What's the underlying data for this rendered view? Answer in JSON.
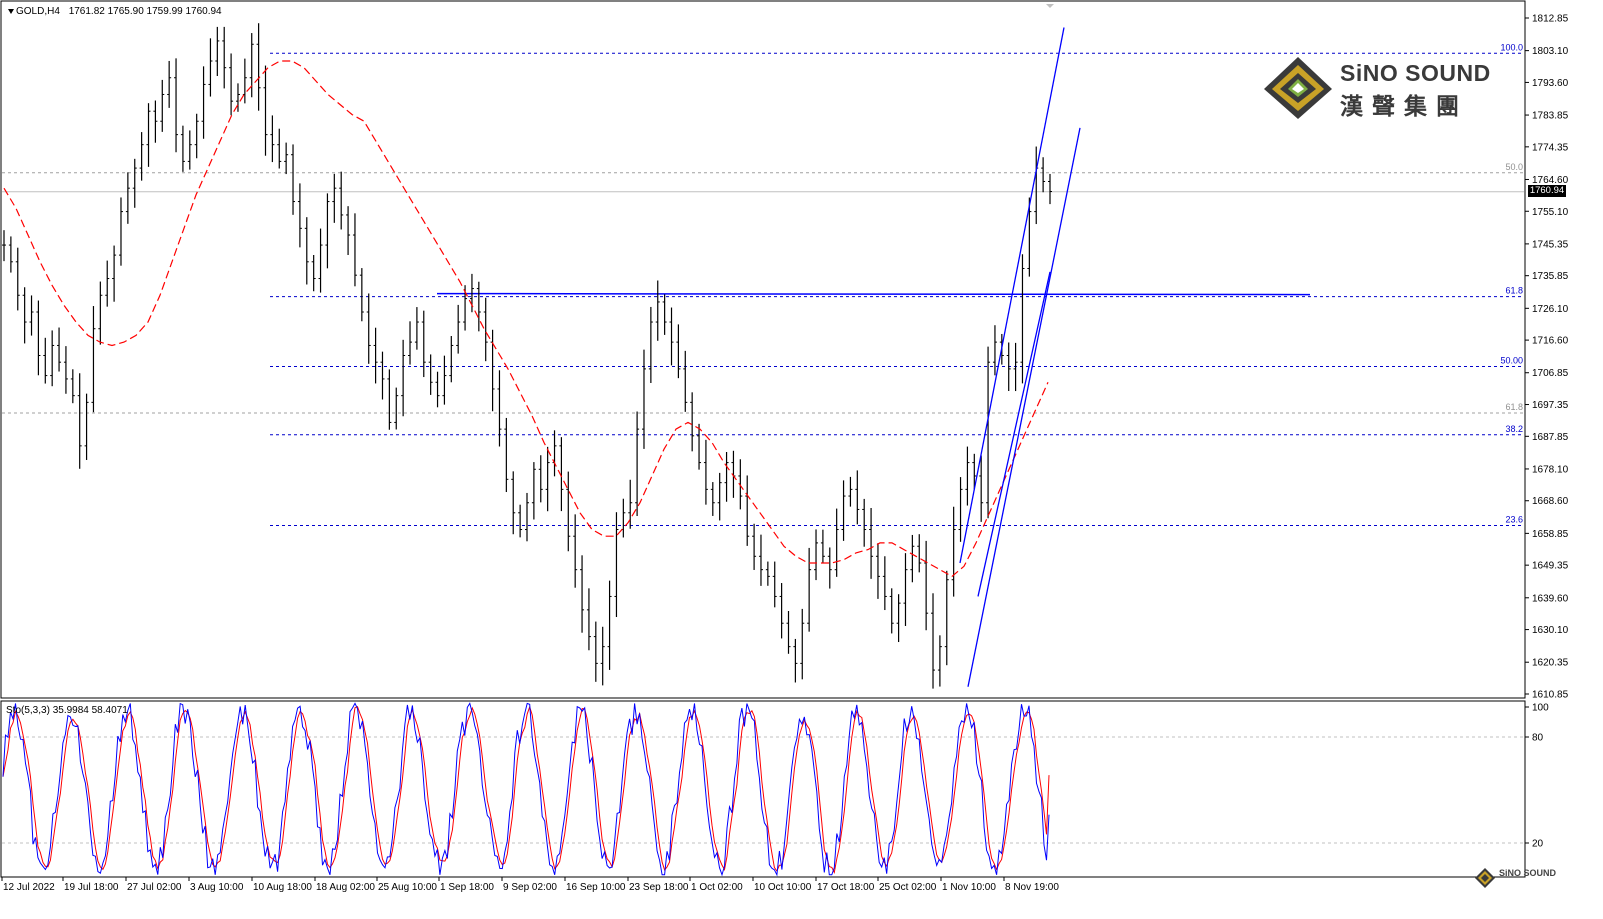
{
  "header": {
    "symbol": "GOLD,H4",
    "ohlc": "1761.82 1765.90 1759.99 1760.94"
  },
  "indicator": {
    "label": "Sto(5,3,3) 35.9984 58.4071",
    "levels": [
      100,
      80,
      20
    ]
  },
  "current_price": "1760.94",
  "logo": {
    "name": "SiNO SOUND",
    "chinese": "漢聲集團",
    "small": "SiNO SOUND"
  },
  "colors": {
    "bars": "#000000",
    "ma": "#ff0000",
    "channel": "#0000ff",
    "fib": "#0000cc",
    "grid_dashed": "#a0a0a0",
    "stoch_main": "#0000ff",
    "stoch_signal": "#ff0000"
  },
  "chart_data": {
    "type": "bar",
    "symbol": "GOLD",
    "timeframe": "H4",
    "y_ticks": [
      "1812.85",
      "1803.10",
      "1793.60",
      "1783.85",
      "1774.35",
      "1764.60",
      "1755.10",
      "1745.35",
      "1735.85",
      "1726.10",
      "1716.60",
      "1706.85",
      "1697.35",
      "1687.85",
      "1678.10",
      "1668.60",
      "1658.85",
      "1649.35",
      "1639.60",
      "1630.10",
      "1620.35",
      "1610.85"
    ],
    "ylim": [
      1610.85,
      1812.85
    ],
    "x_ticks": [
      "12 Jul 2022",
      "19 Jul 18:00",
      "27 Jul 02:00",
      "3 Aug 10:00",
      "10 Aug 18:00",
      "18 Aug 02:00",
      "25 Aug 10:00",
      "1 Sep 18:00",
      "9 Sep 02:00",
      "16 Sep 10:00",
      "23 Sep 18:00",
      "1 Oct 02:00",
      "10 Oct 10:00",
      "17 Oct 18:00",
      "25 Oct 02:00",
      "1 Nov 10:00",
      "8 Nov 19:00"
    ],
    "fib_levels": [
      {
        "label": "100.0",
        "price": 1802.3
      },
      {
        "label": "50.0",
        "price": 1766.6
      },
      {
        "label": "61.8",
        "price": 1729.6
      },
      {
        "label": "50.00",
        "price": 1708.7
      },
      {
        "label": "61.8",
        "price": 1694.8
      },
      {
        "label": "38.2",
        "price": 1688.3
      },
      {
        "label": "23.6",
        "price": 1661.2
      }
    ],
    "resistance_line": 1730.5,
    "price_series": [
      1745,
      1740,
      1730,
      1722,
      1725,
      1712,
      1706,
      1715,
      1710,
      1705,
      1700,
      1685,
      1698,
      1720,
      1730,
      1735,
      1742,
      1755,
      1762,
      1768,
      1775,
      1785,
      1782,
      1790,
      1795,
      1778,
      1770,
      1775,
      1782,
      1793,
      1800,
      1806,
      1798,
      1788,
      1790,
      1795,
      1805,
      1792,
      1778,
      1775,
      1770,
      1772,
      1758,
      1750,
      1740,
      1735,
      1745,
      1758,
      1762,
      1754,
      1748,
      1736,
      1725,
      1715,
      1710,
      1705,
      1692,
      1700,
      1712,
      1716,
      1722,
      1710,
      1704,
      1700,
      1706,
      1715,
      1722,
      1729,
      1732,
      1725,
      1716,
      1702,
      1690,
      1675,
      1665,
      1660,
      1668,
      1678,
      1672,
      1680,
      1685,
      1672,
      1658,
      1648,
      1636,
      1628,
      1620,
      1625,
      1640,
      1660,
      1665,
      1668,
      1690,
      1708,
      1722,
      1728,
      1722,
      1716,
      1708,
      1698,
      1688,
      1680,
      1672,
      1668,
      1674,
      1680,
      1676,
      1670,
      1658,
      1652,
      1648,
      1646,
      1640,
      1632,
      1625,
      1620,
      1632,
      1648,
      1656,
      1652,
      1648,
      1660,
      1670,
      1672,
      1666,
      1660,
      1652,
      1646,
      1640,
      1632,
      1638,
      1648,
      1655,
      1650,
      1635,
      1618,
      1625,
      1645,
      1660,
      1672,
      1680,
      1676,
      1668,
      1710,
      1716,
      1712,
      1708,
      1710,
      1738,
      1755,
      1768,
      1764,
      1761
    ],
    "ma_series": [
      1762,
      1756,
      1748,
      1740,
      1733,
      1727,
      1722,
      1718,
      1716,
      1715,
      1716,
      1718,
      1722,
      1730,
      1740,
      1750,
      1760,
      1768,
      1776,
      1784,
      1790,
      1794,
      1798,
      1800,
      1800,
      1798,
      1794,
      1790,
      1787,
      1784,
      1782,
      1776,
      1770,
      1764,
      1758,
      1752,
      1746,
      1740,
      1734,
      1727,
      1720,
      1714,
      1708,
      1701,
      1694,
      1686,
      1679,
      1672,
      1665,
      1660,
      1658,
      1658,
      1662,
      1668,
      1676,
      1684,
      1690,
      1692,
      1690,
      1686,
      1680,
      1675,
      1670,
      1665,
      1660,
      1655,
      1652,
      1650,
      1650,
      1650,
      1651,
      1653,
      1654,
      1656,
      1656,
      1654,
      1652,
      1650,
      1648,
      1646,
      1649,
      1656,
      1664,
      1672,
      1680,
      1688,
      1696,
      1704
    ],
    "channel": {
      "upper": [
        [
          1612,
          1802
        ],
        [
          1651,
          1823
        ]
      ],
      "lower": [
        [
          1622,
          1612
        ],
        [
          1672,
          1775
        ]
      ],
      "inner_upper": [
        [
          1640,
          1660
        ],
        [
          1660,
          1778
        ]
      ]
    },
    "stochastic": {
      "main_last": 35.9984,
      "signal_last": 58.4071
    }
  }
}
